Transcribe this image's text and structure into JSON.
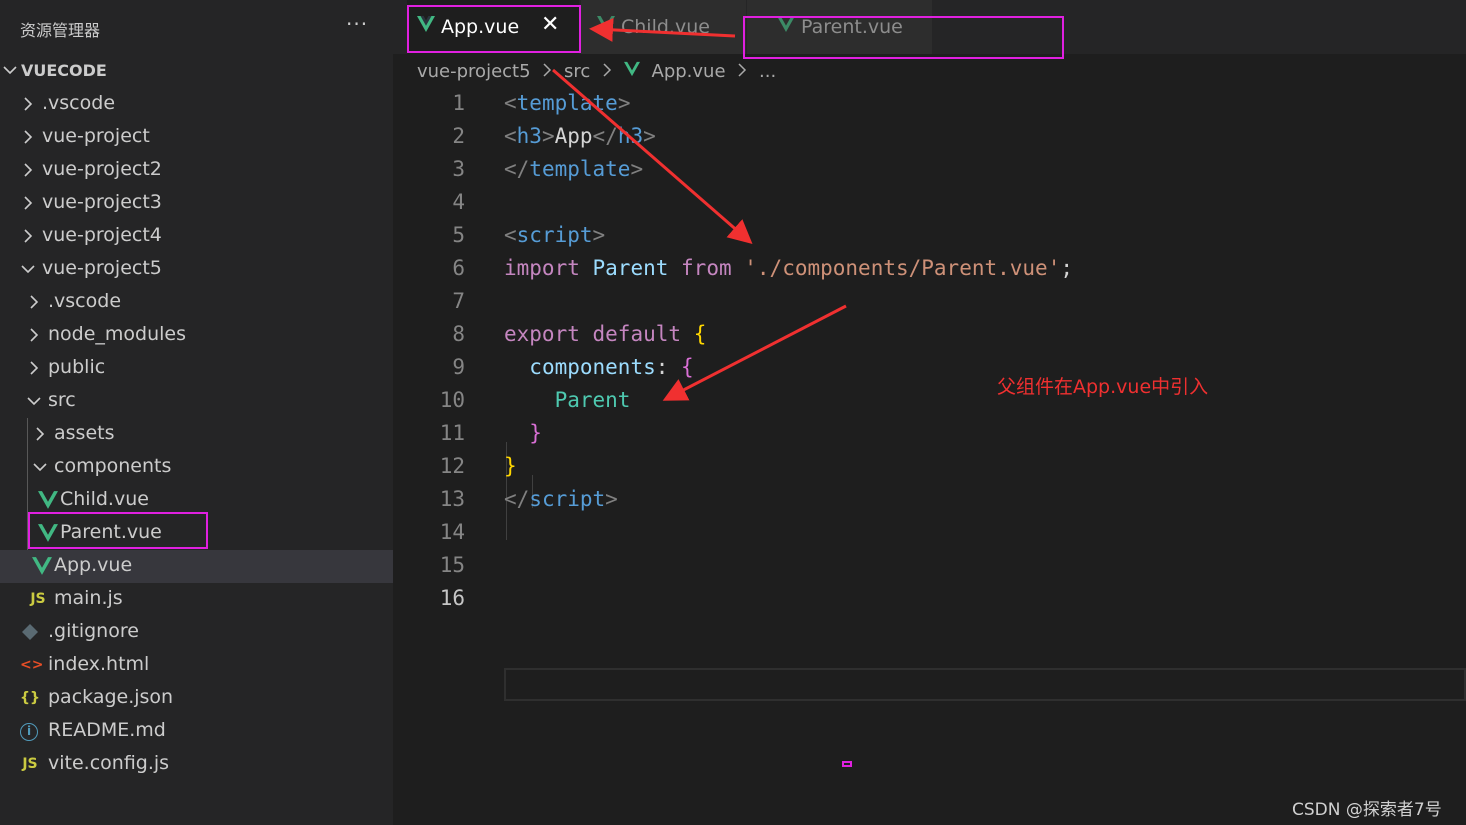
{
  "colors": {
    "vue_green": "#41b883",
    "annotation_magenta": "#e020e0",
    "annotation_red": "#f03030"
  },
  "sidebar": {
    "title": "资源管理器",
    "more_actions": "···",
    "root_label": "VUECODE",
    "items": [
      {
        "label": ".vscode",
        "icon": "chevron-right-icon"
      },
      {
        "label": "vue-project",
        "icon": "chevron-right-icon"
      },
      {
        "label": "vue-project2",
        "icon": "chevron-right-icon"
      },
      {
        "label": "vue-project3",
        "icon": "chevron-right-icon"
      },
      {
        "label": "vue-project4",
        "icon": "chevron-right-icon"
      },
      {
        "label": "vue-project5",
        "icon": "chevron-down-icon"
      },
      {
        "label": ".vscode",
        "icon": "chevron-right-icon"
      },
      {
        "label": "node_modules",
        "icon": "chevron-right-icon"
      },
      {
        "label": "public",
        "icon": "chevron-right-icon"
      },
      {
        "label": "src",
        "icon": "chevron-down-icon"
      },
      {
        "label": "assets",
        "icon": "chevron-right-icon"
      },
      {
        "label": "components",
        "icon": "chevron-down-icon"
      },
      {
        "label": "Child.vue",
        "icon": "vue-file-icon"
      },
      {
        "label": "Parent.vue",
        "icon": "vue-file-icon"
      },
      {
        "label": "App.vue",
        "icon": "vue-file-icon",
        "selected": true
      },
      {
        "label": "main.js",
        "icon": "js-file-icon",
        "icon_text": "JS"
      },
      {
        "label": ".gitignore",
        "icon": "git-file-icon"
      },
      {
        "label": "index.html",
        "icon": "html-file-icon",
        "icon_text": "<>"
      },
      {
        "label": "package.json",
        "icon": "json-file-icon",
        "icon_text": "{}"
      },
      {
        "label": "README.md",
        "icon": "info-file-icon",
        "icon_text": "i"
      },
      {
        "label": "vite.config.js",
        "icon": "js-file-icon",
        "icon_text": "JS"
      }
    ]
  },
  "tabs": [
    {
      "label": "App.vue",
      "active": true,
      "close": "✕"
    },
    {
      "label": "Child.vue",
      "active": false
    },
    {
      "label": "Parent.vue",
      "active": false
    }
  ],
  "breadcrumb": {
    "parts": [
      "vue-project5",
      "src",
      "App.vue",
      "..."
    ]
  },
  "editor": {
    "active_line": 16,
    "lines": [
      {
        "n": "1"
      },
      {
        "n": "2"
      },
      {
        "n": "3"
      },
      {
        "n": "4"
      },
      {
        "n": "5"
      },
      {
        "n": "6"
      },
      {
        "n": "7"
      },
      {
        "n": "8"
      },
      {
        "n": "9"
      },
      {
        "n": "10"
      },
      {
        "n": "11"
      },
      {
        "n": "12"
      },
      {
        "n": "13"
      },
      {
        "n": "14"
      },
      {
        "n": "15"
      },
      {
        "n": "16"
      }
    ],
    "tokens": {
      "lt": "<",
      "gt": ">",
      "lt_slash": "</",
      "template": "template",
      "h3": "h3",
      "app_text": "App",
      "script": "script",
      "import": "import",
      "parent_ident": "Parent",
      "from": "from",
      "path_string": "'./components/Parent.vue'",
      "semicolon": ";",
      "export": "export",
      "default": "default",
      "open_brace": "{",
      "close_brace": "}",
      "components_key": "components",
      "colon": ":",
      "parent_comp": "Parent"
    }
  },
  "annotation": {
    "text": "父组件在App.vue中引入"
  },
  "watermark": "CSDN @探索者7号"
}
